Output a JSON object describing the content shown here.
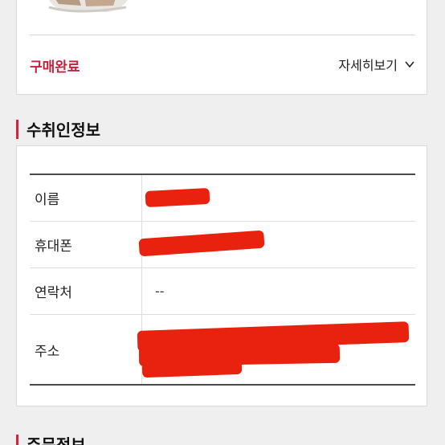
{
  "order": {
    "status": "구매완료",
    "detail_link": "자세히보기",
    "detail_icon": "chevron-down-icon"
  },
  "recipient_section": {
    "title": "수취인정보",
    "rows": [
      {
        "label": "이름",
        "value": "",
        "redacted": true
      },
      {
        "label": "휴대폰",
        "value": "",
        "redacted": true
      },
      {
        "label": "연락처",
        "value": "--",
        "redacted": false
      },
      {
        "label": "주소",
        "value": "",
        "redacted": true
      }
    ]
  },
  "order_section": {
    "title": "주문정보"
  },
  "colors": {
    "accent": "#c6203b",
    "heading_bar": "#d4253d",
    "redaction": "#e8220e",
    "background": "#efefef"
  }
}
